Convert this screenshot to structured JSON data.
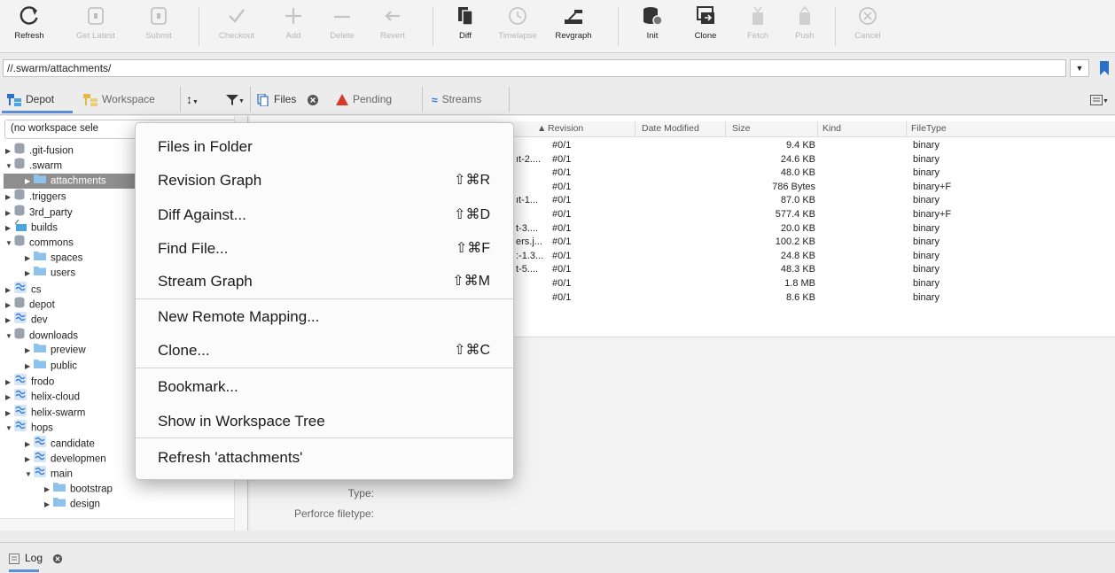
{
  "toolbar": {
    "buttons": [
      {
        "label": "Refresh",
        "icon": "refresh-icon",
        "enabled": true
      },
      {
        "label": "Get Latest",
        "icon": "get-latest-icon",
        "enabled": false
      },
      {
        "label": "Submit",
        "icon": "submit-icon",
        "enabled": false
      },
      {
        "label": "Checkout",
        "icon": "checkmark-icon",
        "enabled": false
      },
      {
        "label": "Add",
        "icon": "plus-icon",
        "enabled": false
      },
      {
        "label": "Delete",
        "icon": "minus-icon",
        "enabled": false
      },
      {
        "label": "Revert",
        "icon": "revert-arrow-icon",
        "enabled": false
      },
      {
        "label": "Diff",
        "icon": "diff-documents-icon",
        "enabled": true
      },
      {
        "label": "Timelapse",
        "icon": "clock-icon",
        "enabled": false
      },
      {
        "label": "Revgraph",
        "icon": "revgraph-icon",
        "enabled": true
      },
      {
        "label": "Init",
        "icon": "database-init-icon",
        "enabled": true
      },
      {
        "label": "Clone",
        "icon": "clone-icon",
        "enabled": true
      },
      {
        "label": "Fetch",
        "icon": "fetch-icon",
        "enabled": false
      },
      {
        "label": "Push",
        "icon": "push-icon",
        "enabled": false
      },
      {
        "label": "Cancel",
        "icon": "cancel-circle-icon",
        "enabled": false
      }
    ]
  },
  "pathbar": {
    "path": "//.swarm/attachments/"
  },
  "tabs": {
    "depot": "Depot",
    "workspace": "Workspace",
    "files": "Files",
    "pending": "Pending",
    "streams": "Streams"
  },
  "left": {
    "workspace_select": "(no workspace sele",
    "tree": [
      {
        "label": ".git-fusion",
        "depth": 0,
        "kind": "depot",
        "expanded": false
      },
      {
        "label": ".swarm",
        "depth": 0,
        "kind": "depot",
        "expanded": true
      },
      {
        "label": "attachments",
        "depth": 1,
        "kind": "folder",
        "expanded": false,
        "selected": true
      },
      {
        "label": ".triggers",
        "depth": 0,
        "kind": "depot",
        "expanded": false
      },
      {
        "label": "3rd_party",
        "depth": 0,
        "kind": "depot",
        "expanded": false
      },
      {
        "label": "builds",
        "depth": 0,
        "kind": "spec",
        "expanded": false
      },
      {
        "label": "commons",
        "depth": 0,
        "kind": "depot",
        "expanded": true
      },
      {
        "label": "spaces",
        "depth": 1,
        "kind": "folder",
        "expanded": false
      },
      {
        "label": "users",
        "depth": 1,
        "kind": "folder",
        "expanded": false
      },
      {
        "label": "cs",
        "depth": 0,
        "kind": "stream",
        "expanded": false
      },
      {
        "label": "depot",
        "depth": 0,
        "kind": "depot",
        "expanded": false
      },
      {
        "label": "dev",
        "depth": 0,
        "kind": "stream",
        "expanded": false
      },
      {
        "label": "downloads",
        "depth": 0,
        "kind": "depot",
        "expanded": true
      },
      {
        "label": "preview",
        "depth": 1,
        "kind": "folder",
        "expanded": false
      },
      {
        "label": "public",
        "depth": 1,
        "kind": "folder",
        "expanded": false
      },
      {
        "label": "frodo",
        "depth": 0,
        "kind": "stream",
        "expanded": false
      },
      {
        "label": "helix-cloud",
        "depth": 0,
        "kind": "stream",
        "expanded": false
      },
      {
        "label": "helix-swarm",
        "depth": 0,
        "kind": "stream",
        "expanded": false
      },
      {
        "label": "hops",
        "depth": 0,
        "kind": "stream",
        "expanded": true
      },
      {
        "label": "candidate",
        "depth": 1,
        "kind": "stream",
        "expanded": false
      },
      {
        "label": "developmen",
        "depth": 1,
        "kind": "stream",
        "expanded": false
      },
      {
        "label": "main",
        "depth": 1,
        "kind": "stream",
        "expanded": true
      },
      {
        "label": "bootstrap",
        "depth": 2,
        "kind": "folder",
        "expanded": false
      },
      {
        "label": "design",
        "depth": 2,
        "kind": "folder",
        "expanded": false
      }
    ]
  },
  "files": {
    "columns": {
      "revision": "Revision",
      "date_modified": "Date Modified",
      "size": "Size",
      "kind": "Kind",
      "filetype": "FileType"
    },
    "rows": [
      {
        "name": "",
        "revision": "#0/1",
        "size": "9.4 KB",
        "filetype": "binary"
      },
      {
        "name": "ıt-2....",
        "revision": "#0/1",
        "size": "24.6 KB",
        "filetype": "binary"
      },
      {
        "name": "",
        "revision": "#0/1",
        "size": "48.0 KB",
        "filetype": "binary"
      },
      {
        "name": "",
        "revision": "#0/1",
        "size": "786 Bytes",
        "filetype": "binary+F"
      },
      {
        "name": "ıt-1...",
        "revision": "#0/1",
        "size": "87.0 KB",
        "filetype": "binary"
      },
      {
        "name": "",
        "revision": "#0/1",
        "size": "577.4 KB",
        "filetype": "binary+F"
      },
      {
        "name": "t-3....",
        "revision": "#0/1",
        "size": "20.0 KB",
        "filetype": "binary"
      },
      {
        "name": "ers.j...",
        "revision": "#0/1",
        "size": "100.2 KB",
        "filetype": "binary"
      },
      {
        "name": ":-1.3...",
        "revision": "#0/1",
        "size": "24.8 KB",
        "filetype": "binary"
      },
      {
        "name": "t-5....",
        "revision": "#0/1",
        "size": "48.3 KB",
        "filetype": "binary"
      },
      {
        "name": "",
        "revision": "#0/1",
        "size": "1.8 MB",
        "filetype": "binary"
      },
      {
        "name": "",
        "revision": "#0/1",
        "size": "8.6 KB",
        "filetype": "binary"
      }
    ],
    "details": {
      "type_label": "Type:",
      "perforce_filetype_label": "Perforce filetype:"
    }
  },
  "log": {
    "label": "Log"
  },
  "context_menu": {
    "items": [
      {
        "label": "Files in Folder",
        "shortcut": ""
      },
      {
        "label": "Revision Graph",
        "shortcut": "⇧⌘R"
      },
      {
        "label": "Diff Against...",
        "shortcut": "⇧⌘D"
      },
      {
        "label": "Find File...",
        "shortcut": "⇧⌘F"
      },
      {
        "label": "Stream Graph",
        "shortcut": "⇧⌘M"
      },
      {
        "label": "New Remote Mapping...",
        "shortcut": ""
      },
      {
        "label": "Clone...",
        "shortcut": "⇧⌘C"
      },
      {
        "label": "Bookmark...",
        "shortcut": ""
      },
      {
        "label": "Show in Workspace Tree",
        "shortcut": ""
      },
      {
        "label": "Refresh 'attachments'",
        "shortcut": ""
      }
    ]
  },
  "colors": {
    "accent_blue": "#2a6fc9",
    "stream_blue": "#3d7fd1",
    "depot_gray": "#9aa3ad",
    "folder_blue": "#8fc2ea",
    "selected_row": "#8e8e8e",
    "pending_red": "#d83a2a"
  }
}
